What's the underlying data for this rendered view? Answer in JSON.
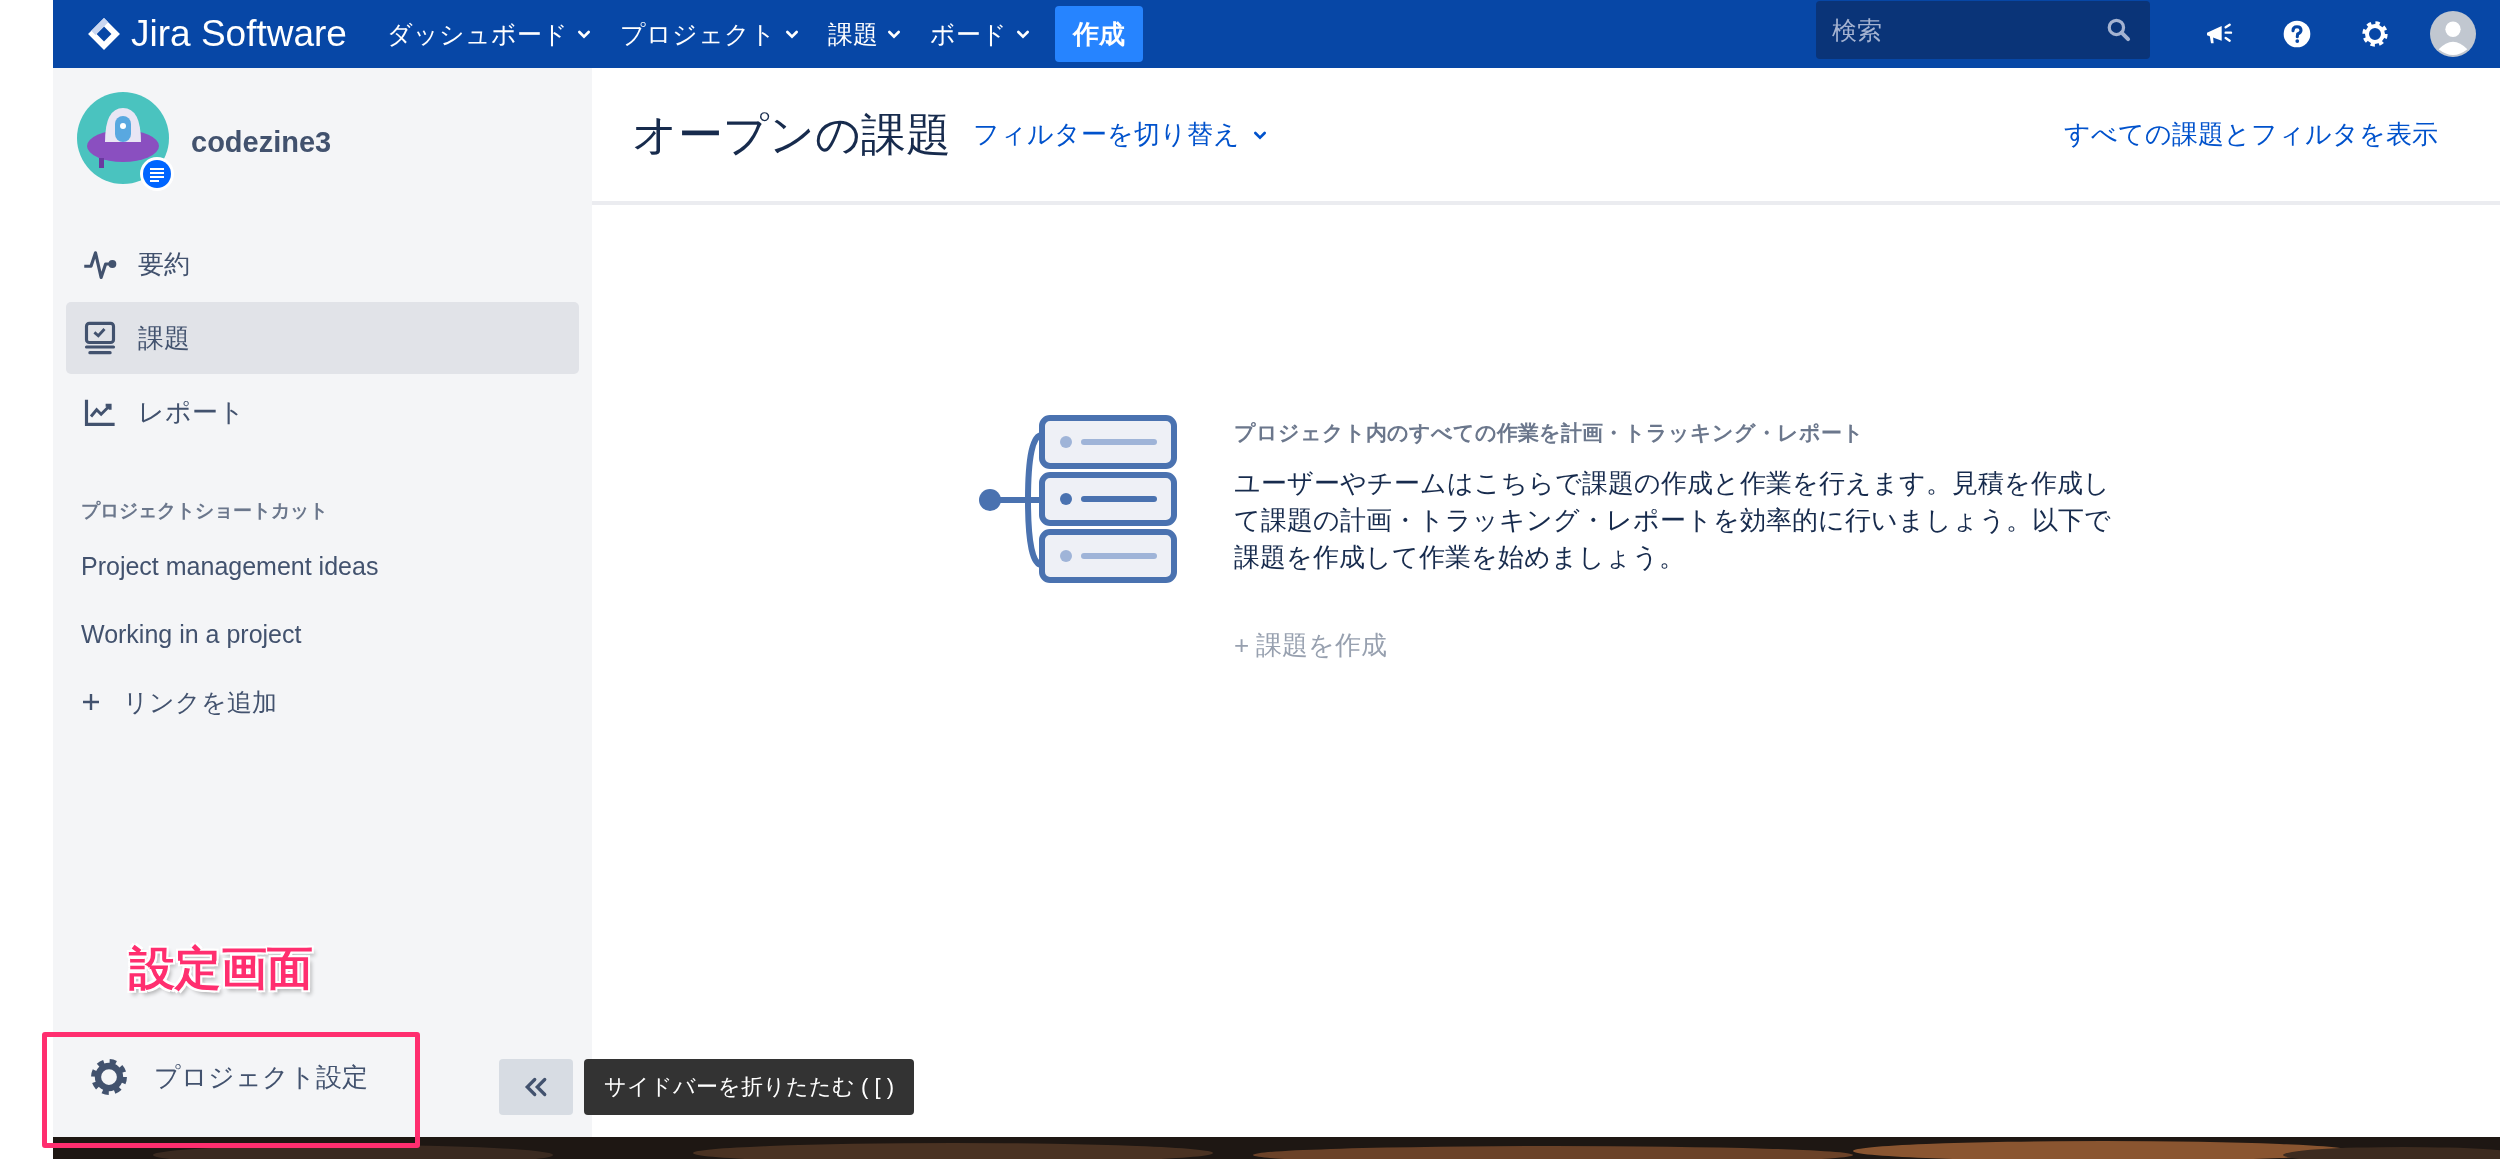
{
  "topbar": {
    "logo": "Jira Software",
    "nav": [
      {
        "label": "ダッシュボード",
        "dropdown": true
      },
      {
        "label": "プロジェクト",
        "dropdown": true
      },
      {
        "label": "課題",
        "dropdown": true
      },
      {
        "label": "ボード",
        "dropdown": true
      }
    ],
    "create_button": "作成",
    "search": {
      "placeholder": "検索"
    }
  },
  "sidebar": {
    "project_name": "codezine3",
    "items": [
      {
        "label": "要約",
        "kind": "summary",
        "selected": false
      },
      {
        "label": "課題",
        "kind": "issues",
        "selected": true
      },
      {
        "label": "レポート",
        "kind": "reports",
        "selected": false
      }
    ],
    "shortcuts_heading": "プロジェクトショートカット",
    "shortcuts": [
      "Project management ideas",
      "Working in a project"
    ],
    "add_link": "リンクを追加",
    "settings": "プロジェクト設定",
    "collapse_tooltip": "サイドバーを折りたたむ ( [ )"
  },
  "annotation": {
    "label": "設定画面"
  },
  "main": {
    "title": "オープンの課題",
    "filter_switch": "フィルターを切り替え",
    "view_all": "すべての課題とフィルタを表示",
    "empty_state": {
      "heading": "プロジェクト内のすべての作業を計画・トラッキング・レポート",
      "body": "ユーザーやチームはこちらで課題の作成と作業を行えます。見積を作成して課題の計画・トラッキング・レポートを効率的に行いましょう。以下で課題を作成して作業を始めましょう。",
      "create_link": "+ 課題を作成"
    }
  }
}
